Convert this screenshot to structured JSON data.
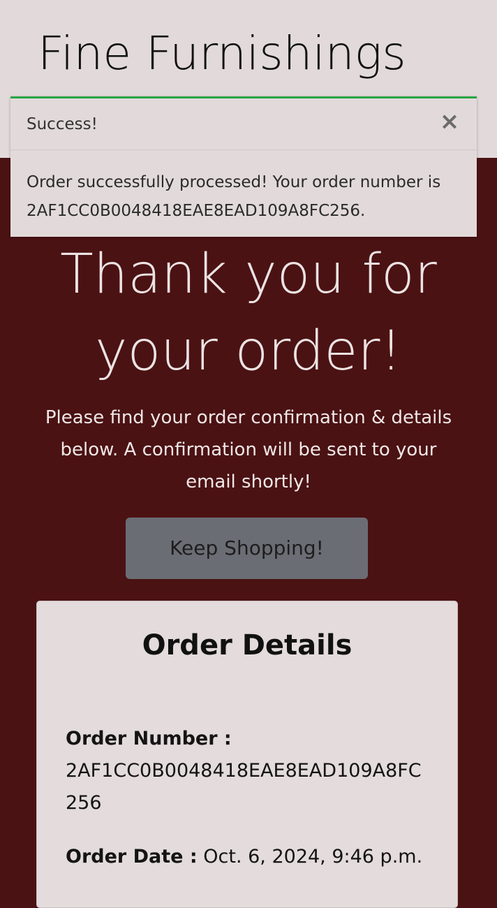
{
  "header": {
    "brand": "Fine Furnishings"
  },
  "toast": {
    "title": "Success!",
    "close_label": "×",
    "message": "Order successfully processed! Your order number is 2AF1CC0B0048418EAE8EAD109A8FC256."
  },
  "hero": {
    "title": "Thank you for your order!",
    "subtitle": "Please find your order confirmation & details below. A confirmation will be sent to your email shortly!",
    "button_label": "Keep Shopping!"
  },
  "order_details": {
    "title": "Order Details",
    "number_label": "Order Number :",
    "number_value": "2AF1CC0B0048418EAE8EAD109A8FC256",
    "date_label": "Order Date :",
    "date_value": "Oct. 6, 2024, 9:46 p.m."
  },
  "colors": {
    "background": "#4b1213",
    "header": "#e2dada",
    "success": "#28a745",
    "button": "#6b6d75"
  }
}
